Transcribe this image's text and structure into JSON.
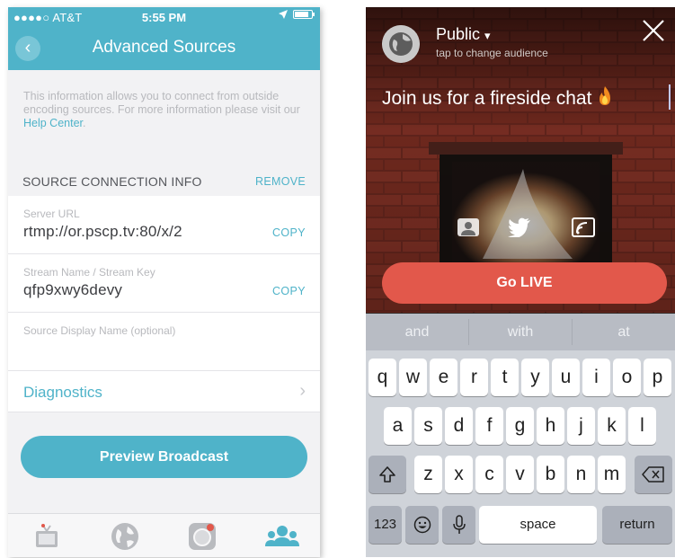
{
  "left": {
    "status": {
      "carrier": "●●●●○ AT&T",
      "time": "5:55 PM"
    },
    "nav": {
      "back_label": "‹",
      "title": "Advanced Sources"
    },
    "info": {
      "text": "This information allows you to connect from outside encoding sources. For more information please visit our ",
      "link": "Help Center",
      "end": "."
    },
    "section": {
      "title": "SOURCE CONNECTION INFO",
      "action": "REMOVE"
    },
    "fields": [
      {
        "label": "Server URL",
        "value": "rtmp://or.pscp.tv:80/x/2",
        "action": "COPY"
      },
      {
        "label": "Stream Name / Stream Key",
        "value": "qfp9xwy6devy",
        "action": "COPY"
      },
      {
        "label": "Source Display Name (optional)",
        "value": "",
        "action": ""
      }
    ],
    "diagnostics": {
      "label": "Diagnostics",
      "chevron": "›"
    },
    "preview_button": "Preview Broadcast",
    "tabs": [
      "tv-icon",
      "globe-icon",
      "camera-record-icon",
      "people-icon"
    ],
    "colors": {
      "accent": "#4fb3c9",
      "background": "#f2f2f4"
    }
  },
  "right": {
    "audience": {
      "title": "Public",
      "caret": "▾",
      "subtitle": "tap to change audience"
    },
    "close_icon": "close-icon",
    "broadcast_title": "Join us for a fireside chat",
    "title_emoji_icon": "fire-icon",
    "share_icons": [
      "user-icon",
      "twitter-icon",
      "external-source-icon"
    ],
    "go_live": "Go LIVE",
    "suggestions": [
      "and",
      "with",
      "at"
    ],
    "keyboard": {
      "row1": [
        "q",
        "w",
        "e",
        "r",
        "t",
        "y",
        "u",
        "i",
        "o",
        "p"
      ],
      "row2": [
        "a",
        "s",
        "d",
        "f",
        "g",
        "h",
        "j",
        "k",
        "l"
      ],
      "row3": [
        "z",
        "x",
        "c",
        "v",
        "b",
        "n",
        "m"
      ],
      "numbers": "123",
      "space": "space",
      "return": "return"
    },
    "colors": {
      "go_live": "#e2584b"
    }
  }
}
